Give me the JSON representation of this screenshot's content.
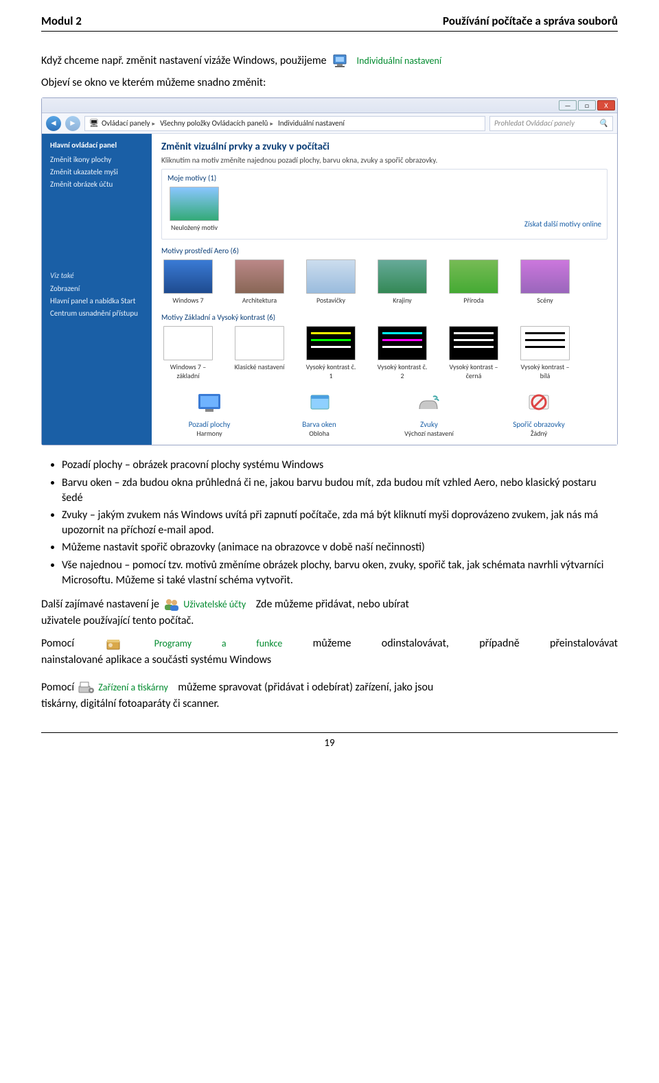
{
  "header": {
    "left": "Modul 2",
    "right": "Používání počítače a správa souborů"
  },
  "intro1": "Když chceme např. změnit nastavení vizáže Windows, použijeme",
  "intro1_link": "Individuální nastavení",
  "intro2": "Objeví se okno ve kterém můžeme snadno změnit:",
  "screenshot": {
    "winbtns": {
      "min": "—",
      "max": "□",
      "close": "X"
    },
    "breadcrumb": [
      "Ovládací panely",
      "Všechny položky Ovládacích panelů",
      "Individuální nastavení"
    ],
    "search_placeholder": "Prohledat Ovládací panely",
    "sidepane": {
      "heading": "Hlavní ovládací panel",
      "links": [
        "Změnit ikony plochy",
        "Změnit ukazatele myši",
        "Změnit obrázek účtu"
      ],
      "section2_heading": "Viz také",
      "section2_links": [
        "Zobrazení",
        "Hlavní panel a nabídka Start",
        "Centrum usnadnění přístupu"
      ]
    },
    "main": {
      "title": "Změnit vizuální prvky a zvuky v počítači",
      "subtitle": "Kliknutím na motiv změníte najednou pozadí plochy, barvu okna, zvuky a spořič obrazovky.",
      "group1_title": "Moje motivy (1)",
      "group1_items": [
        {
          "label": "Neuložený motiv"
        }
      ],
      "more_online": "Získat další motivy online",
      "group2_title": "Motivy prostředí Aero (6)",
      "group2_items": [
        {
          "label": "Windows 7",
          "bg": "linear-gradient(#3a7bd5,#1e4b8f)"
        },
        {
          "label": "Architektura",
          "bg": "linear-gradient(#b88,#865)"
        },
        {
          "label": "Postavičky",
          "bg": "linear-gradient(#cde,#9bd)"
        },
        {
          "label": "Krajiny",
          "bg": "linear-gradient(#6a9,#385)"
        },
        {
          "label": "Příroda",
          "bg": "linear-gradient(#7b5,#4a3)"
        },
        {
          "label": "Scény",
          "bg": "linear-gradient(#c7d,#96b)"
        }
      ],
      "group3_title": "Motivy Základní a Vysoký kontrast (6)",
      "group3_items": [
        {
          "label": "Windows 7 – základní",
          "bg": "#fff"
        },
        {
          "label": "Klasické nastavení",
          "bg": "#fff"
        },
        {
          "label": "Vysoký kontrast č. 1",
          "bg": "#000",
          "bars": [
            "#ff0",
            "#0f0",
            "#fff"
          ]
        },
        {
          "label": "Vysoký kontrast č. 2",
          "bg": "#000",
          "bars": [
            "#0ff",
            "#f0f",
            "#fff"
          ]
        },
        {
          "label": "Vysoký kontrast – černá",
          "bg": "#000",
          "bars": [
            "#fff",
            "#fff",
            "#fff"
          ]
        },
        {
          "label": "Vysoký kontrast – bílá",
          "bg": "#fff",
          "bars": [
            "#000",
            "#000",
            "#000"
          ]
        }
      ],
      "bottom": [
        {
          "link": "Pozadí plochy",
          "sub": "Harmony"
        },
        {
          "link": "Barva oken",
          "sub": "Obloha"
        },
        {
          "link": "Zvuky",
          "sub": "Výchozí nastavení"
        },
        {
          "link": "Spořič obrazovky",
          "sub": "Žádný"
        }
      ]
    }
  },
  "bullets": [
    "Pozadí plochy – obrázek pracovní plochy systému Windows",
    "Barvu oken – zda budou okna průhledná či ne, jakou barvu budou mít, zda budou mít vzhled Aero, nebo klasický postaru šedé",
    "Zvuky – jakým zvukem nás Windows uvítá při zapnutí počítače, zda má být kliknutí myši doprovázeno zvukem, jak nás má upozornit na příchozí e-mail apod.",
    "Můžeme nastavit spořič obrazovky (animace na obrazovce v době naší nečinnosti)",
    "Vše najednou – pomocí tzv. motivů změníme obrázek plochy, barvu oken, zvuky, spořič tak, jak schémata navrhli výtvarníci Microsoftu. Můžeme si také vlastní schéma vytvořit."
  ],
  "p_users_a": "Další zajímavé nastavení je",
  "p_users_link": "Uživatelské účty",
  "p_users_b": "Zde můžeme přidávat, nebo ubírat",
  "p_users_c": "uživatele používající tento počítač.",
  "p_prog_a": "Pomocí",
  "p_prog_link": "Programy a funkce",
  "p_prog_b": "můžeme",
  "p_prog_c": "odinstalovávat,",
  "p_prog_d": "případně",
  "p_prog_e": "přeinstalovávat",
  "p_prog_f": "nainstalované aplikace a součásti systému Windows",
  "p_dev_a": "Pomocí",
  "p_dev_link": "Zařízení a tiskárny",
  "p_dev_b": "můžeme spravovat (přidávat i odebírat) zařízení, jako jsou",
  "p_dev_c": "tiskárny, digitální fotoaparáty či scanner.",
  "page_number": "19"
}
